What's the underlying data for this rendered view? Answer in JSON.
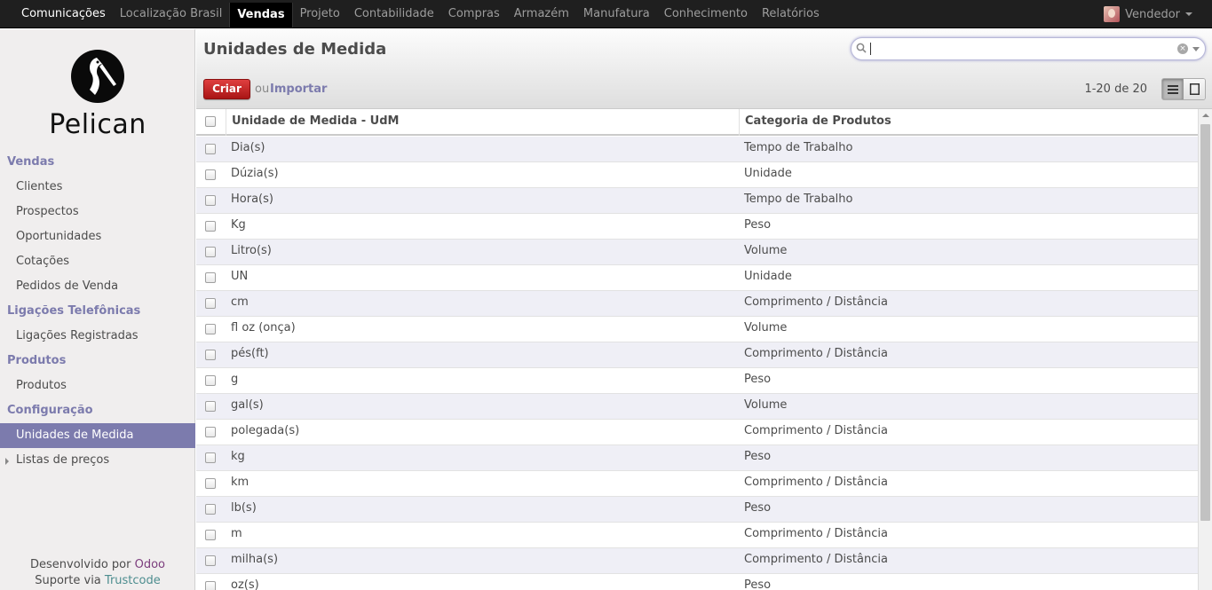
{
  "topmenu": {
    "items": [
      "Comunicações",
      "Localização Brasil",
      "Vendas",
      "Projeto",
      "Contabilidade",
      "Compras",
      "Armazém",
      "Manufatura",
      "Conhecimento",
      "Relatórios"
    ],
    "active": "Vendas",
    "user": "Vendedor"
  },
  "sidebar": {
    "logo_text": "Pelican",
    "sections": [
      {
        "title": "Vendas",
        "items": [
          "Clientes",
          "Prospectos",
          "Oportunidades",
          "Cotações",
          "Pedidos de Venda"
        ]
      },
      {
        "title": "Ligações Telefônicas",
        "items": [
          "Ligações Registradas"
        ]
      },
      {
        "title": "Produtos",
        "items": [
          "Produtos"
        ]
      },
      {
        "title": "Configuração",
        "items": [
          "Unidades de Medida",
          "Listas de preços"
        ]
      }
    ],
    "selected": "Unidades de Medida",
    "footer": {
      "dev_prefix": "Desenvolvido por",
      "dev_name": "Odoo",
      "support_prefix": "Suporte via",
      "support_name": "Trustcode"
    }
  },
  "header": {
    "title": "Unidades de Medida",
    "search_value": "",
    "create_label": "Criar",
    "or_label": "ou",
    "import_label": "Importar",
    "pager": "1-20 de 20"
  },
  "table": {
    "columns": [
      "Unidade de Medida - UdM",
      "Categoria de Produtos"
    ],
    "rows": [
      [
        "Dia(s)",
        "Tempo de Trabalho"
      ],
      [
        "Dúzia(s)",
        "Unidade"
      ],
      [
        "Hora(s)",
        "Tempo de Trabalho"
      ],
      [
        "Kg",
        "Peso"
      ],
      [
        "Litro(s)",
        "Volume"
      ],
      [
        "UN",
        "Unidade"
      ],
      [
        "cm",
        "Comprimento / Distância"
      ],
      [
        "fl oz (onça)",
        "Volume"
      ],
      [
        "pés(ft)",
        "Comprimento / Distância"
      ],
      [
        "g",
        "Peso"
      ],
      [
        "gal(s)",
        "Volume"
      ],
      [
        "polegada(s)",
        "Comprimento / Distância"
      ],
      [
        "kg",
        "Peso"
      ],
      [
        "km",
        "Comprimento / Distância"
      ],
      [
        "lb(s)",
        "Peso"
      ],
      [
        "m",
        "Comprimento / Distância"
      ],
      [
        "milha(s)",
        "Comprimento / Distância"
      ],
      [
        "oz(s)",
        "Peso"
      ]
    ]
  },
  "colors": {
    "accent": "#7c7bad",
    "create_button": "#c12b2b",
    "topbar": "#1f1f1f"
  }
}
